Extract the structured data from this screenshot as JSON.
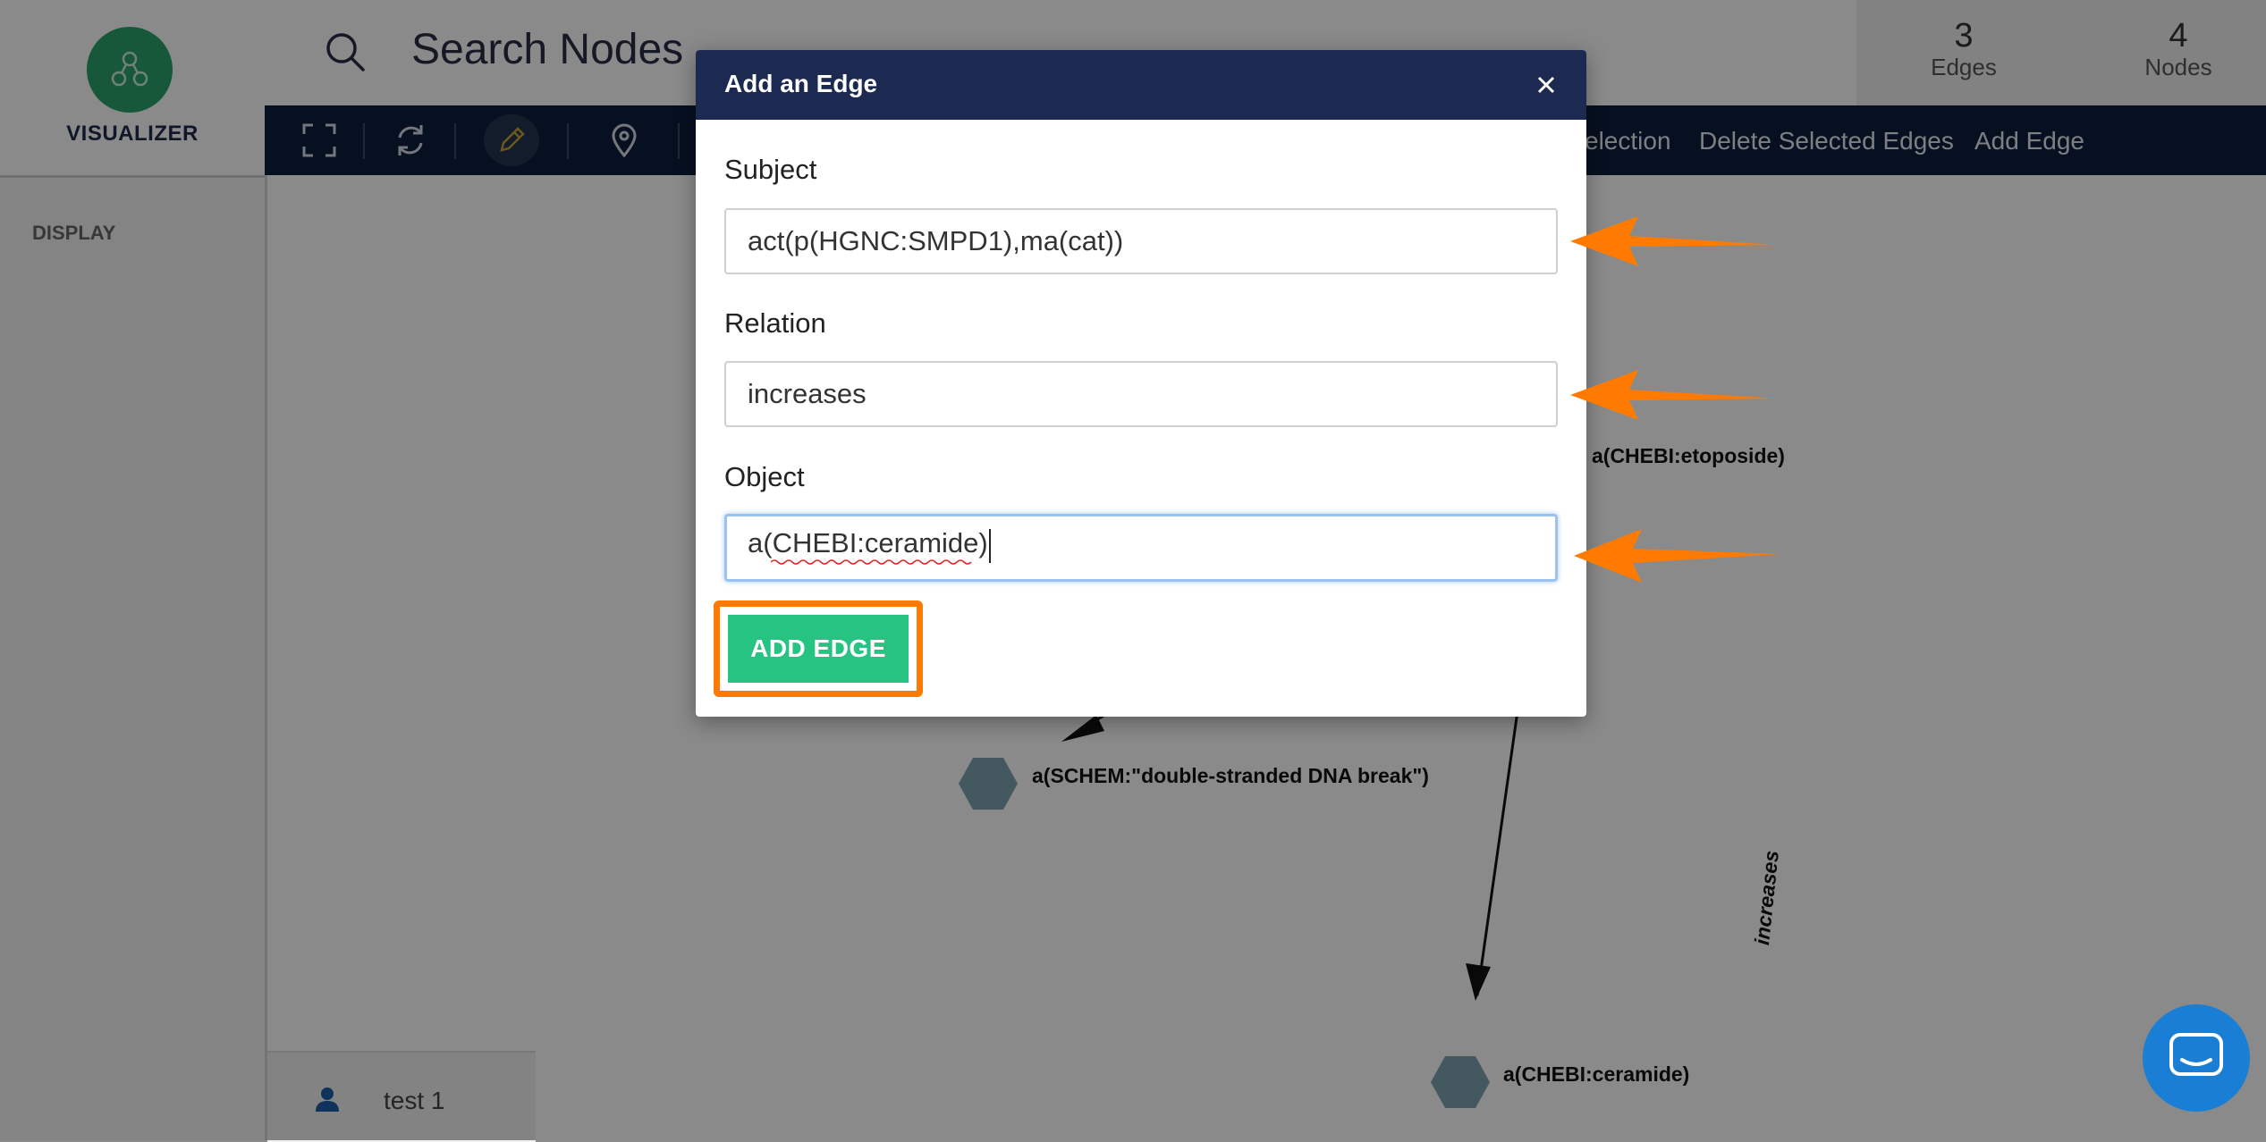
{
  "app": {
    "logo_text": "VISUALIZER",
    "display_label": "DISPLAY",
    "search_placeholder": "Search Nodes",
    "edges_count": "3",
    "edges_label": "Edges",
    "nodes_count": "4",
    "nodes_label": "Nodes",
    "toolbar_links": [
      "election",
      "Delete Selected Edges",
      "Add Edge"
    ],
    "icons": [
      "expand-icon",
      "refresh-icon",
      "pencil-icon",
      "pin-icon"
    ],
    "user_name": "test 1",
    "colors": {
      "toolbar": "#0d1f3c",
      "logo": "#2aa36a",
      "primary_button": "#26c383",
      "highlight": "#ff7a00",
      "modal_header": "#1c2a52"
    }
  },
  "graph": {
    "nodes": [
      "a(CHEBI:etoposide)",
      "a(SCHEM:\"double-stranded DNA break\")",
      "a(CHEBI:ceramide)"
    ],
    "edge_label": "increases"
  },
  "modal": {
    "title": "Add an Edge",
    "subject_label": "Subject",
    "subject_value": "act(p(HGNC:SMPD1),ma(cat))",
    "relation_label": "Relation",
    "relation_value": "increases",
    "object_label": "Object",
    "object_value": "a(CHEBI:ceramide)",
    "submit_label": "ADD EDGE"
  }
}
